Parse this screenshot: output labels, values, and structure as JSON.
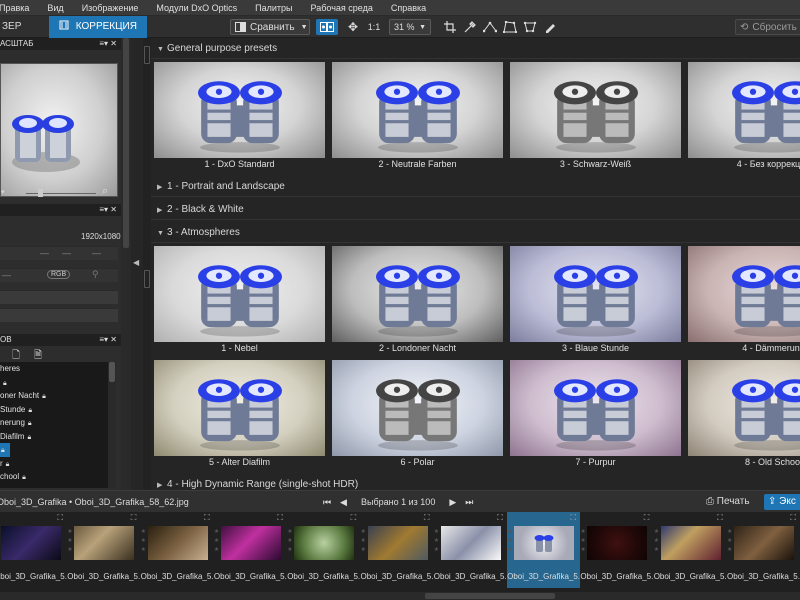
{
  "menu": [
    "Правка",
    "Вид",
    "Изображение",
    "Модули DxO Optics",
    "Палитры",
    "Рабочая среда",
    "Справка"
  ],
  "tabs": {
    "organize": "ЗЕР",
    "correction": "КОРРЕКЦИЯ"
  },
  "toolbar": {
    "compare": "Сравнить",
    "zoom_one": "1:1",
    "zoom_value": "31 %",
    "reset": "Сбросить"
  },
  "left": {
    "navigator_title": "АСШТАБ",
    "histogram_size": "1920x1080",
    "rgb_label": "RGB",
    "presets_title": "ОВ",
    "preset_list": [
      "heres",
      "",
      "oner Nacht",
      "Stunde",
      "nerung",
      "Diafilm",
      "",
      "r",
      "chool",
      ""
    ]
  },
  "groups": [
    {
      "title": "General purpose presets",
      "expanded": true
    },
    {
      "title": "1 - Portrait and Landscape",
      "expanded": false
    },
    {
      "title": "2 - Black & White",
      "expanded": false
    },
    {
      "title": "3 - Atmospheres",
      "expanded": true
    },
    {
      "title": "4 - High Dynamic Range (single-shot HDR)",
      "expanded": false
    }
  ],
  "general_presets": [
    "1 - DxO Standard",
    "2 - Neutrale Farben",
    "3 - Schwarz-Weiß",
    "4 - Без коррекции"
  ],
  "atmospheres_row1": [
    "1 - Nebel",
    "2 - Londoner Nacht",
    "3 - Blaue Stunde",
    "4 - Dämmerung"
  ],
  "atmospheres_row2": [
    "5 - Alter Diafilm",
    "6 - Polar",
    "7 - Purpur",
    "8 - Old School"
  ],
  "filmbar": {
    "path": "Oboi_3D_Grafika • Oboi_3D_Grafika_58_62.jpg",
    "selected_count": "Выбрано 1 из 100",
    "print": "Печать",
    "export": "Экс"
  },
  "filmstrip": [
    "Oboi_3D_Grafika_5...",
    "Oboi_3D_Grafika_5...",
    "Oboi_3D_Grafika_5...",
    "Oboi_3D_Grafika_5...",
    "Oboi_3D_Grafika_5...",
    "Oboi_3D_Grafika_5...",
    "Oboi_3D_Grafika_5...",
    "Oboi_3D_Grafika_5...",
    "Oboi_3D_Grafika_5...",
    "Oboi_3D_Grafika_5...",
    "Oboi_3D_Grafika_5..."
  ],
  "colors": {
    "accent": "#1f76b5",
    "panel": "#2d2d2d",
    "background": "#252525"
  }
}
